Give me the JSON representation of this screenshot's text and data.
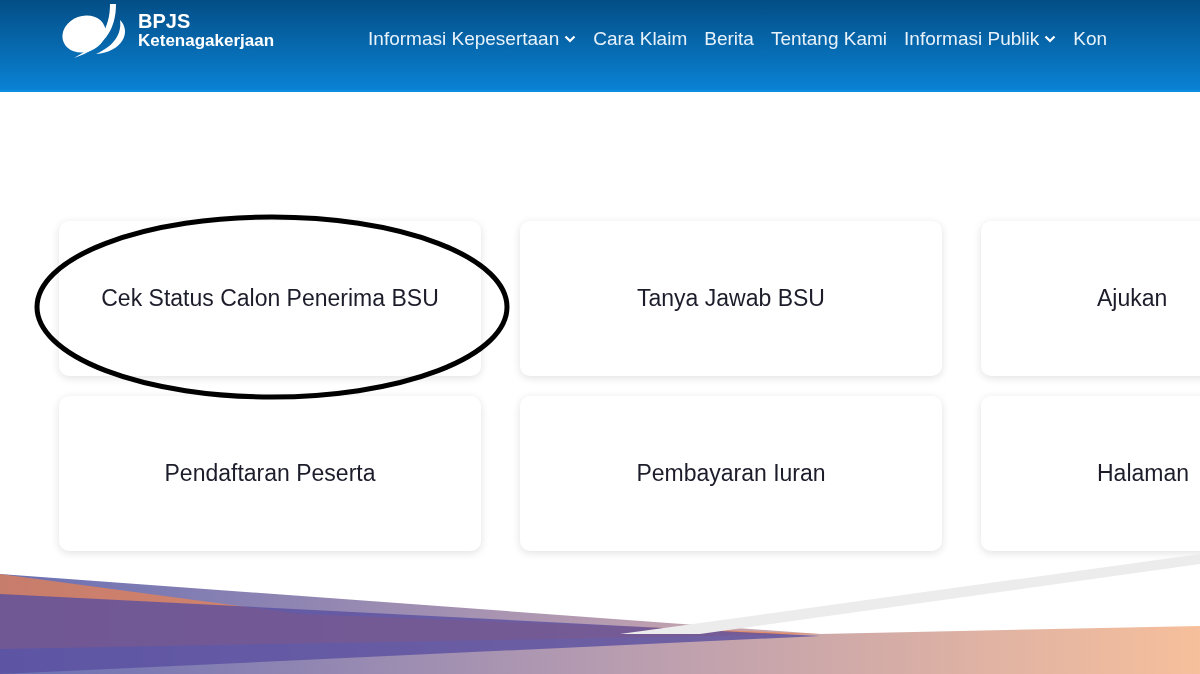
{
  "header": {
    "logo": {
      "title": "BPJS",
      "subtitle": "Ketenagakerjaan"
    },
    "nav": [
      {
        "label": "Informasi Kepesertaan",
        "has_dropdown": true
      },
      {
        "label": "Cara Klaim",
        "has_dropdown": false
      },
      {
        "label": "Berita",
        "has_dropdown": false
      },
      {
        "label": "Tentang Kami",
        "has_dropdown": false
      },
      {
        "label": "Informasi Publik",
        "has_dropdown": true
      },
      {
        "label": "Kon",
        "has_dropdown": false
      }
    ]
  },
  "cards": [
    {
      "label": "Cek Status Calon Penerima BSU",
      "circled": true
    },
    {
      "label": "Tanya Jawab BSU",
      "circled": false
    },
    {
      "label": "Ajukan",
      "circled": false
    },
    {
      "label": "Pendaftaran Peserta",
      "circled": false
    },
    {
      "label": "Pembayaran Iuran",
      "circled": false
    },
    {
      "label": "Halaman",
      "circled": false
    }
  ]
}
